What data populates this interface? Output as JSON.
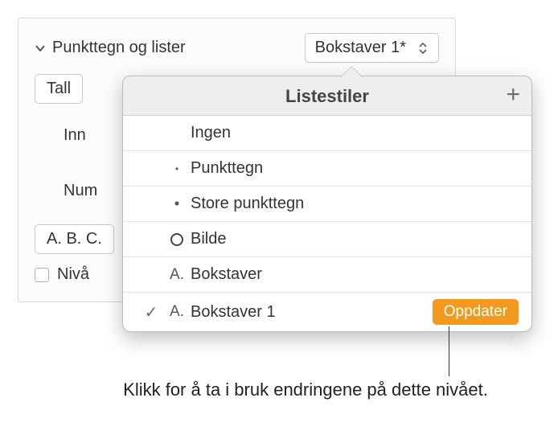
{
  "panel": {
    "section_label": "Punkttegn og lister",
    "style_dropdown": "Bokstaver 1*",
    "tall_dropdown": "Tall",
    "indent_label": "Inn",
    "num_label": "Num",
    "abc_dropdown": "A. B. C.",
    "niva_label": "Nivå"
  },
  "popover": {
    "title": "Listestiler",
    "items": [
      {
        "label": "Ingen",
        "prefix": "",
        "type": "none"
      },
      {
        "label": "Punkttegn",
        "prefix": "•",
        "type": "bullet-small"
      },
      {
        "label": "Store punkttegn",
        "prefix": "•",
        "type": "bullet-large"
      },
      {
        "label": "Bilde",
        "prefix": "",
        "type": "circle"
      },
      {
        "label": "Bokstaver",
        "prefix": "A.",
        "type": "letter"
      },
      {
        "label": "Bokstaver 1",
        "prefix": "A.",
        "type": "letter",
        "selected": true
      }
    ],
    "update_label": "Oppdater"
  },
  "callout": "Klikk for å ta i bruk endringene på dette nivået."
}
